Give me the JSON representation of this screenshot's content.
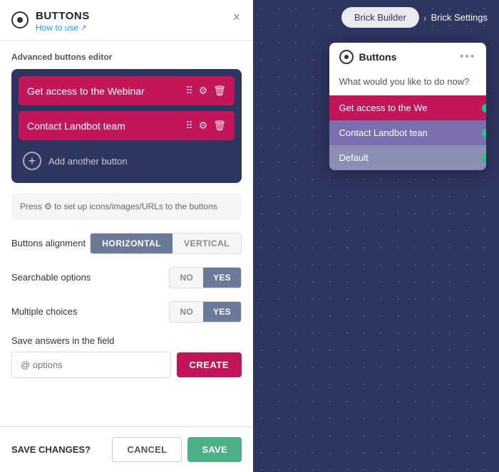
{
  "panel": {
    "title": "BUTTONS",
    "link_text": "How to use",
    "link_icon": "↗",
    "close_icon": "×",
    "editor_title": "Advanced buttons editor",
    "buttons": [
      {
        "label": "Get access to the Webinar"
      },
      {
        "label": "Contact Landbot team"
      }
    ],
    "add_button_label": "Add another button",
    "hint_text": "Press  to set up icons/images/URLs to the buttons",
    "alignment_label": "Buttons alignment",
    "alignment_options": [
      {
        "label": "HORIZONTAL",
        "active": true
      },
      {
        "label": "VERTICAL",
        "active": false
      }
    ],
    "searchable_label": "Searchable options",
    "searchable_no": "NO",
    "searchable_yes": "YES",
    "multiple_label": "Multiple choices",
    "multiple_no": "NO",
    "multiple_yes": "YES",
    "save_answers_label": "Save answers in the field",
    "save_input_placeholder": "@ options",
    "create_btn_label": "CREATE",
    "footer_label": "SAVE CHANGES?",
    "cancel_label": "CANCEL",
    "save_label": "SAVE"
  },
  "right": {
    "nav": {
      "brick_builder": "Brick Builder",
      "chevron": "›",
      "brick_settings": "Brick Settings"
    },
    "card": {
      "title": "Buttons",
      "menu_icon": "•••",
      "question": "What would you like to do now?",
      "buttons": [
        {
          "label": "Get access to the We",
          "color": "red"
        },
        {
          "label": "Contact Landbot tean",
          "color": "purple"
        },
        {
          "label": "Default",
          "color": "gray"
        }
      ]
    }
  }
}
